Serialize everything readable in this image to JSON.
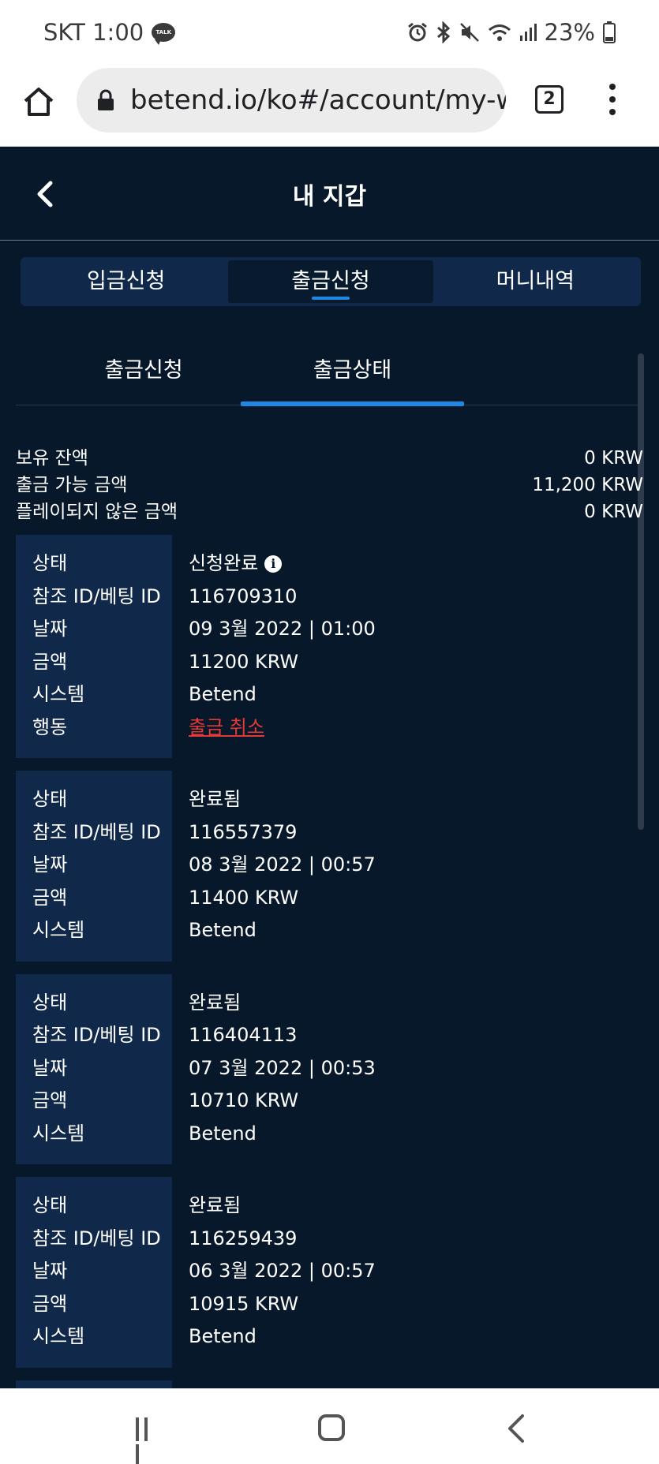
{
  "status_bar": {
    "carrier_time": "SKT 1:00",
    "talk_badge": "TALK",
    "battery": "23%",
    "icons": [
      "alarm-icon",
      "bluetooth-icon",
      "mute-icon",
      "wifi-icon",
      "signal-icon",
      "battery-icon"
    ]
  },
  "browser": {
    "url": "betend.io/ko#/account/my-wallet",
    "tab_count": "2"
  },
  "header": {
    "title": "내 지갑"
  },
  "main_tabs": [
    {
      "label": "입금신청",
      "active": false
    },
    {
      "label": "출금신청",
      "active": true
    },
    {
      "label": "머니내역",
      "active": false
    }
  ],
  "sub_tabs": [
    {
      "label": "출금신청",
      "active": false
    },
    {
      "label": "출금상태",
      "active": true
    }
  ],
  "balance": {
    "held_label": "보유 잔액",
    "held_value": "0 KRW",
    "withdrawable_label": "출금 가능 금액",
    "withdrawable_value": "11,200 KRW",
    "unplayed_label": "플레이되지 않은 금액",
    "unplayed_value": "0 KRW"
  },
  "labels": {
    "status": "상태",
    "ref_id": "참조 ID/베팅 ID",
    "date": "날짜",
    "amount": "금액",
    "system": "시스템",
    "action": "행동"
  },
  "records": [
    {
      "status": "신청완료",
      "ref_id": "116709310",
      "date": "09 3월 2022 | 01:00",
      "amount": "11200 KRW",
      "system": "Betend",
      "action": "출금 취소"
    },
    {
      "status": "완료됨",
      "ref_id": "116557379",
      "date": "08 3월 2022 | 00:57",
      "amount": "11400 KRW",
      "system": "Betend"
    },
    {
      "status": "완료됨",
      "ref_id": "116404113",
      "date": "07 3월 2022 | 00:53",
      "amount": "10710 KRW",
      "system": "Betend"
    },
    {
      "status": "완료됨",
      "ref_id": "116259439",
      "date": "06 3월 2022 | 00:57",
      "amount": "10915 KRW",
      "system": "Betend"
    }
  ],
  "colors": {
    "background": "#08182b",
    "panel": "#10294a",
    "accent": "#1e88e5",
    "danger": "#e53935"
  }
}
